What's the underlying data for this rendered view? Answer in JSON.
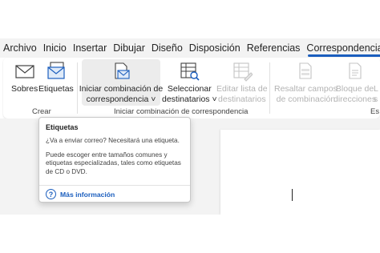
{
  "tabs": [
    "Archivo",
    "Inicio",
    "Insertar",
    "Dibujar",
    "Diseño",
    "Disposición",
    "Referencias",
    "Correspondencia"
  ],
  "ribbon": {
    "sobres": "Sobres",
    "etiquetas": "Etiquetas",
    "iniciar_l1": "Iniciar combinación de",
    "iniciar_l2": "correspondencia ˅",
    "seleccionar_l1": "Seleccionar",
    "seleccionar_l2": "destinatarios ˅",
    "editar_l1": "Editar lista de",
    "editar_l2": "destinatarios",
    "resaltar_l1": "Resaltar campos",
    "resaltar_l2": "de combinación",
    "bloque_l1": "Bloque de",
    "bloque_l2": "direcciones",
    "cut_l1": "L",
    "cut_l2": "s",
    "group_crear": "Crear",
    "group_iniciar": "Iniciar combinación de correspondencia",
    "group_cut": "Es"
  },
  "tooltip": {
    "title": "Etiquetas",
    "line1": "¿Va a enviar correo? Necesitará una etiqueta.",
    "line2": "Puede escoger entre tamaños comunes y etiquetas especializadas, tales como etiquetas de CD o DVD.",
    "more": "Más información"
  },
  "icons": {
    "sobres": "envelope-icon",
    "etiquetas": "labels-icon",
    "iniciar": "start-mail-merge-icon",
    "seleccionar": "select-recipients-icon",
    "editar": "edit-recipient-list-icon",
    "resaltar": "highlight-merge-fields-icon",
    "bloque": "address-block-icon",
    "help": "help-icon"
  },
  "colors": {
    "accent": "#1b5ebe",
    "disabled": "#b3b3b3"
  }
}
